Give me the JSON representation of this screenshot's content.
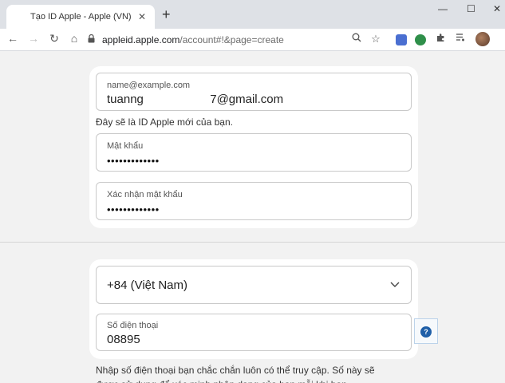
{
  "browser": {
    "tab": {
      "title": "Tạo ID Apple - Apple (VN)",
      "favicon": "apple-logo-icon",
      "close": "✕"
    },
    "new_tab": "+",
    "window_controls": {
      "minimize": "—",
      "maximize": "☐",
      "close": "✕"
    },
    "nav": {
      "back": "←",
      "forward": "→",
      "reload": "↻",
      "home": "⌂"
    },
    "url_domain": "appleid.apple.com",
    "url_path": "/account#!&page=create",
    "toolbar_icons": [
      "zoom-icon",
      "bookmark-star-icon",
      "translate-icon",
      "extension-icon",
      "puzzle-extensions-icon",
      "media-control-icon",
      "profile-avatar"
    ]
  },
  "form": {
    "email": {
      "label": "name@example.com",
      "value": "tuanng                    7@gmail.com"
    },
    "email_hint": "Đây sẽ là ID Apple mới của bạn.",
    "password": {
      "label": "Mật khẩu",
      "value": "•••••••••••••"
    },
    "confirm_password": {
      "label": "Xác nhận mật khẩu",
      "value": "•••••••••••••"
    },
    "country_code": {
      "value": "+84 (Việt Nam)"
    },
    "phone": {
      "label": "Số điện thoại",
      "value": "08895"
    },
    "help": "?",
    "description": "Nhập số điện thoại bạn chắc chắn luôn có thể truy cập. Số này sẽ được sử dụng để xác minh nhận dạng của bạn mỗi khi bạn"
  },
  "colors": {
    "accent": "#1f5fa8",
    "page_bg": "#f2f2f2",
    "card_bg": "#ffffff"
  }
}
